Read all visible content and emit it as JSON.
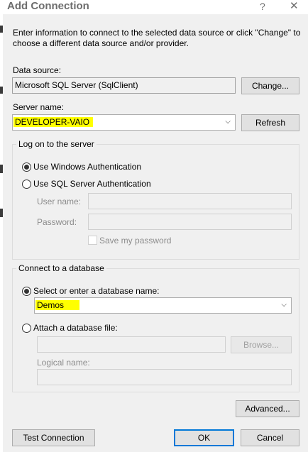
{
  "window": {
    "title": "Add Connection",
    "help_glyph": "?",
    "close_glyph": "✕"
  },
  "intro": {
    "line1": "Enter information to connect to the selected data source or click \"Change\" to",
    "line2": "choose a different data source and/or provider."
  },
  "data_source": {
    "label": "Data source:",
    "value": "Microsoft SQL Server (SqlClient)",
    "change_button": "Change..."
  },
  "server": {
    "label": "Server name:",
    "value": "DEVELOPER-VAIO",
    "refresh_button": "Refresh"
  },
  "logon": {
    "legend": "Log on to the server",
    "windows_auth": "Use Windows Authentication",
    "sql_auth": "Use SQL Server Authentication",
    "user_label": "User name:",
    "user_value": "",
    "password_label": "Password:",
    "password_value": "",
    "save_password": "Save my password",
    "selected": "windows"
  },
  "database": {
    "legend": "Connect to a database",
    "select_option": "Select or enter a database name:",
    "db_value": "Demos",
    "attach_option": "Attach a database file:",
    "file_value": "",
    "browse_button": "Browse...",
    "logical_label": "Logical name:",
    "logical_value": ""
  },
  "footer": {
    "advanced_button": "Advanced...",
    "test_button": "Test Connection",
    "ok_button": "OK",
    "cancel_button": "Cancel"
  },
  "colors": {
    "highlight": "#ffff00",
    "default_button_border": "#0078d7",
    "dialog_background": "#f0f0f0"
  },
  "icons": {
    "dropdown": "chevron-down-icon"
  }
}
